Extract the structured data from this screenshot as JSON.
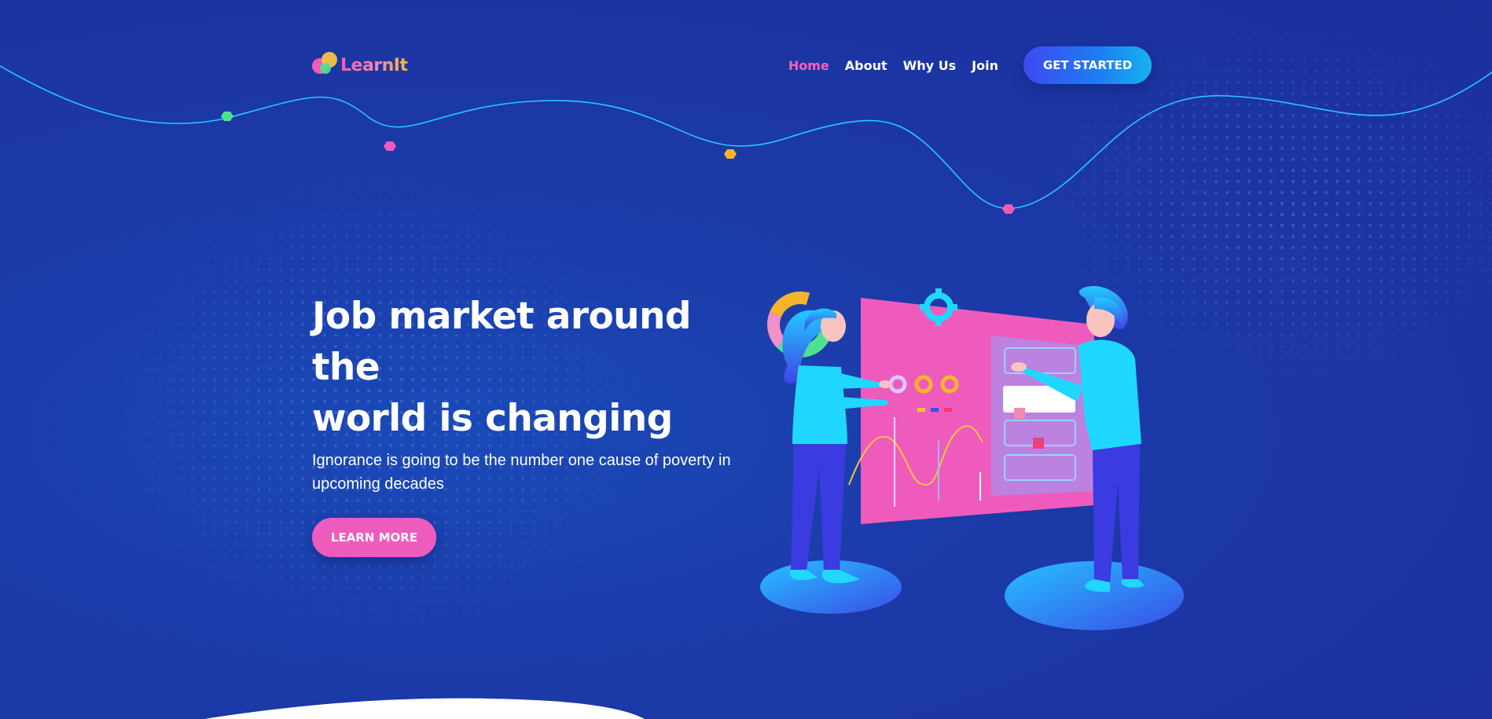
{
  "brand": {
    "name_prefix": "Learn",
    "name_suffix": "It",
    "colors": {
      "pink": "#f45ab9",
      "yellow": "#f6c343",
      "green": "#4ee28f"
    }
  },
  "nav": {
    "items": [
      {
        "label": "Home",
        "active": true
      },
      {
        "label": "About",
        "active": false
      },
      {
        "label": "Why Us",
        "active": false
      },
      {
        "label": "Join",
        "active": false
      }
    ],
    "cta_label": "GET STARTED"
  },
  "hero": {
    "title_line1": "Job market around the",
    "title_line2": "world is changing",
    "subtitle_line1": "Ignorance is going to be the number one cause of poverty in",
    "subtitle_line2": "upcoming decades",
    "button_label": "LEARN MORE"
  },
  "theme": {
    "background": "#1b3aa8",
    "accent_pink": "#ef5bbd",
    "accent_cyan": "#1fd7ff",
    "wave_line": "#27c7ff"
  },
  "decor": {
    "wave_markers": [
      {
        "color": "#4ee28f",
        "icon": "hexagon-marker-icon"
      },
      {
        "color": "#f45ab9",
        "icon": "hexagon-marker-icon"
      },
      {
        "color": "#f6b42b",
        "icon": "hexagon-marker-icon"
      },
      {
        "color": "#f45ab9",
        "icon": "hexagon-marker-icon"
      }
    ],
    "illustration_icon": "team-dashboard-illustration-icon"
  }
}
